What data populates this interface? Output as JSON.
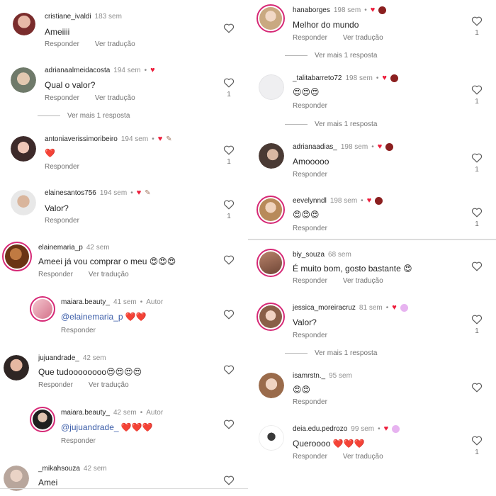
{
  "left": {
    "comments": [
      {
        "username": "cristiane_ivaldi",
        "time": "183 sem",
        "text": "Ameiiii",
        "reply": "Responder",
        "translate": "Ver tradução"
      },
      {
        "username": "adrianaalmeidacosta",
        "time": "194 sem",
        "dot": "•",
        "text": "Qual o valor?",
        "reply": "Responder",
        "translate": "Ver tradução",
        "likes": "1",
        "view_more": "Ver mais 1 resposta"
      },
      {
        "username": "antoniaverissimoribeiro",
        "time": "194 sem",
        "dot": "•",
        "text": "❤️",
        "reply": "Responder",
        "likes": "1"
      },
      {
        "username": "elainesantos756",
        "time": "194 sem",
        "dot": "•",
        "text": "Valor?",
        "reply": "Responder",
        "likes": "1"
      },
      {
        "username": "elainemaria_p",
        "time": "42 sem",
        "text": "Ameei já vou comprar o meu 😍😍😍",
        "reply": "Responder",
        "translate": "Ver tradução"
      },
      {
        "username": "maiara.beauty_",
        "time": "41 sem",
        "dot": "•",
        "author": "Autor",
        "mention": "@elainemaria_p",
        "text": " ❤️❤️",
        "reply": "Responder"
      },
      {
        "username": "jujuandrade_",
        "time": "42 sem",
        "text": "Que tudoooooooo😍😍😍😍",
        "reply": "Responder",
        "translate": "Ver tradução"
      },
      {
        "username": "maiara.beauty_",
        "time": "42 sem",
        "dot": "•",
        "author": "Autor",
        "mention": "@jujuandrade_",
        "text": " ❤️❤️❤️",
        "reply": "Responder"
      },
      {
        "username": "_mikahsouza",
        "time": "42 sem",
        "text": "Amei"
      }
    ]
  },
  "right": {
    "comments": [
      {
        "username": "hanaborges",
        "time": "198 sem",
        "dot": "•",
        "text": "Melhor do mundo",
        "reply": "Responder",
        "translate": "Ver tradução",
        "likes": "1",
        "view_more": "Ver mais 1 resposta"
      },
      {
        "username": "_talitabarreto72",
        "time": "198 sem",
        "dot": "•",
        "text": "😍😍😍",
        "reply": "Responder",
        "likes": "1",
        "view_more": "Ver mais 1 resposta"
      },
      {
        "username": "adrianaadias_",
        "time": "198 sem",
        "dot": "•",
        "text": "Amooooo",
        "reply": "Responder",
        "likes": "1"
      },
      {
        "username": "eevelynndl",
        "time": "198 sem",
        "dot": "•",
        "text": "😍😍😍",
        "reply": "Responder",
        "likes": "1"
      },
      {
        "username": "biy_souza",
        "time": "68 sem",
        "text": "É muito bom, gosto bastante 😍",
        "reply": "Responder",
        "translate": "Ver tradução"
      },
      {
        "username": "jessica_moreiracruz",
        "time": "81 sem",
        "dot": "•",
        "text": "Valor?",
        "reply": "Responder",
        "likes": "1",
        "view_more": "Ver mais 1 resposta"
      },
      {
        "username": "isamrstn._",
        "time": "95 sem",
        "text": "😍😍",
        "reply": "Responder"
      },
      {
        "username": "deia.edu.pedrozo",
        "time": "99 sem",
        "dot": "•",
        "text": "Queroooo ❤️❤️❤️",
        "reply": "Responder",
        "translate": "Ver tradução",
        "likes": "1"
      }
    ]
  },
  "icons": {
    "like": "heart-outline-icon",
    "creator_like": "heart-filled-icon",
    "creator_badge": "creator-avatar-badge-icon"
  },
  "colors": {
    "heart": "#ed1c3a",
    "story_ring": "#d62976",
    "mention": "#3a5ca8",
    "secondary_text": "#737373"
  }
}
